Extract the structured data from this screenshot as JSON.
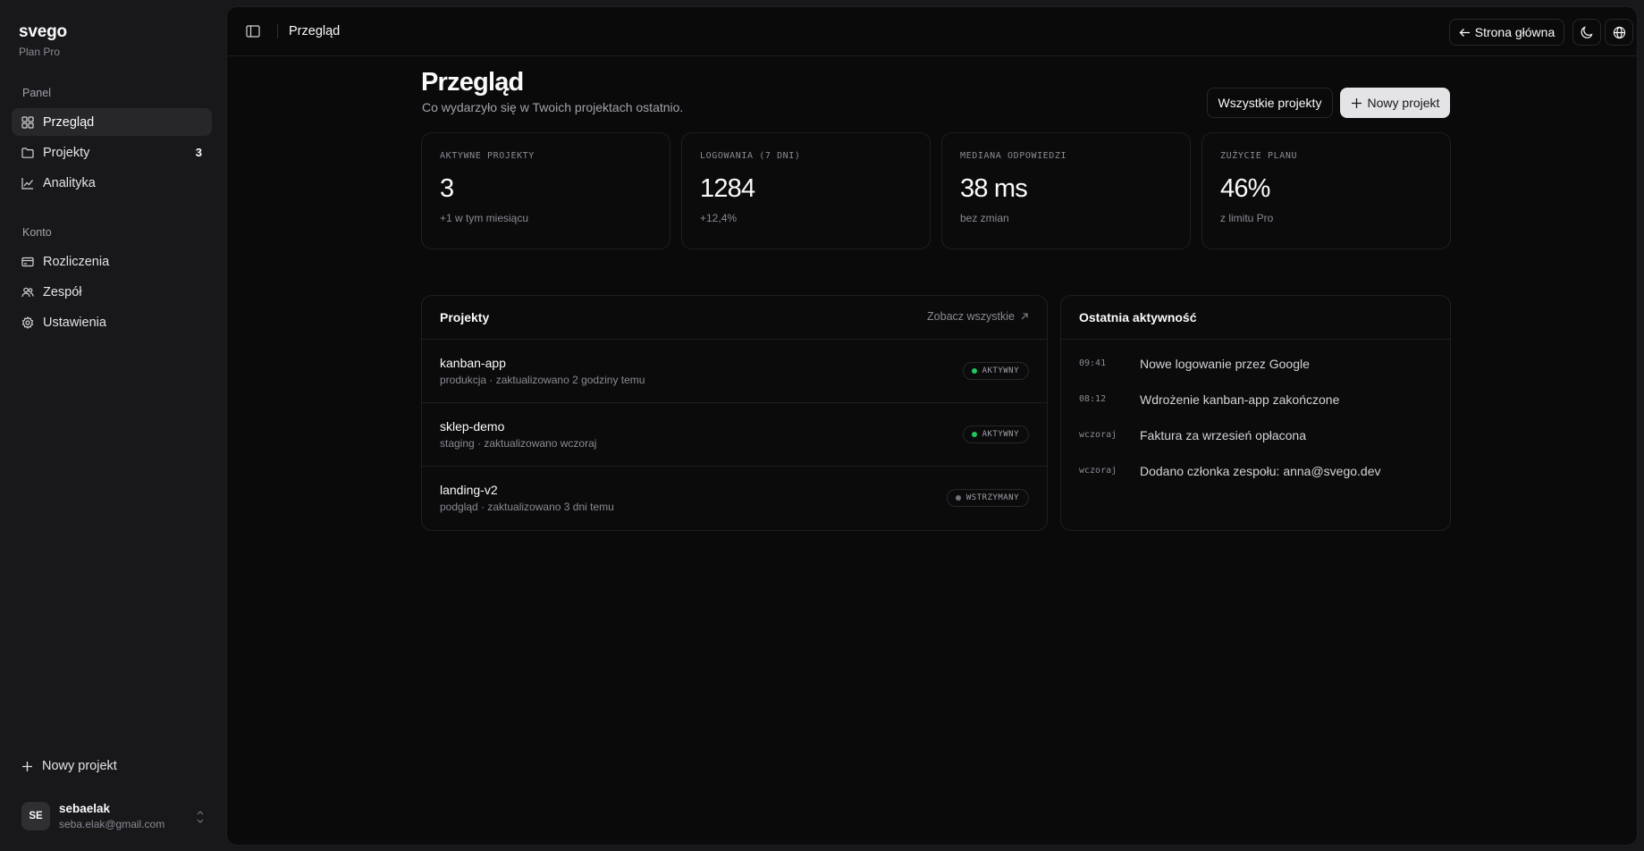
{
  "brand": {
    "name": "svego",
    "plan": "Plan Pro"
  },
  "sidebar": {
    "panel_label": "Panel",
    "account_label": "Konto",
    "panel_items": [
      {
        "label": "Przegląd",
        "icon": "grid-icon",
        "active": true
      },
      {
        "label": "Projekty",
        "icon": "folder-icon",
        "badge": "3"
      },
      {
        "label": "Analityka",
        "icon": "chart-line-icon"
      }
    ],
    "account_items": [
      {
        "label": "Rozliczenia",
        "icon": "card-icon"
      },
      {
        "label": "Zespół",
        "icon": "users-icon"
      },
      {
        "label": "Ustawienia",
        "icon": "gear-icon"
      }
    ],
    "new_project": "Nowy projekt",
    "user": {
      "initials": "SE",
      "name": "sebaelak",
      "email": "seba.elak@gmail.com"
    }
  },
  "topbar": {
    "title": "Przegląd",
    "home_label": "Strona główna"
  },
  "header": {
    "title": "Przegląd",
    "subtitle": "Co wydarzyło się w Twoich projektach ostatnio.",
    "all_projects": "Wszystkie projekty",
    "new_project": "Nowy projekt"
  },
  "stats": [
    {
      "label": "AKTYWNE PROJEKTY",
      "value": "3",
      "note": "+1 w tym miesiącu"
    },
    {
      "label": "LOGOWANIA (7 DNI)",
      "value": "1284",
      "note": "+12,4%"
    },
    {
      "label": "MEDIANA ODPOWIEDZI",
      "value": "38 ms",
      "note": "bez zmian"
    },
    {
      "label": "ZUŻYCIE PLANU",
      "value": "46%",
      "note": "z limitu Pro"
    }
  ],
  "projects": {
    "title": "Projekty",
    "see_all": "Zobacz wszystkie",
    "rows": [
      {
        "name": "kanban-app",
        "meta": "produkcja · zaktualizowano 2 godziny temu",
        "status": "AKTYWNY",
        "status_color": "#22c55e"
      },
      {
        "name": "sklep-demo",
        "meta": "staging · zaktualizowano wczoraj",
        "status": "AKTYWNY",
        "status_color": "#22c55e"
      },
      {
        "name": "landing-v2",
        "meta": "podgląd · zaktualizowano 3 dni temu",
        "status": "WSTRZYMANY",
        "status_color": "#71717a"
      }
    ]
  },
  "activity": {
    "title": "Ostatnia aktywność",
    "items": [
      {
        "time": "09:41",
        "text": "Nowe logowanie przez Google"
      },
      {
        "time": "08:12",
        "text": "Wdrożenie kanban-app zakończone"
      },
      {
        "time": "wczoraj",
        "text": "Faktura za wrzesień opłacona"
      },
      {
        "time": "wczoraj",
        "text": "Dodano członka zespołu: anna@svego.dev"
      }
    ]
  }
}
